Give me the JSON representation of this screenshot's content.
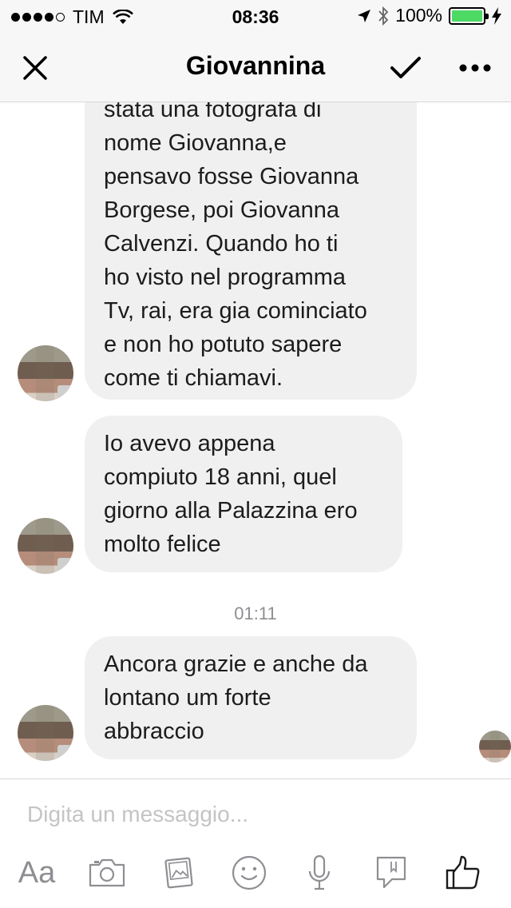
{
  "status_bar": {
    "carrier": "TIM",
    "time": "08:36",
    "battery": "100%",
    "signal_bars_filled": 4,
    "signal_bars_total": 5,
    "battery_level": 1.0,
    "battery_color": "#4cd964"
  },
  "header": {
    "title": "Giovannina",
    "close_icon": "close-icon",
    "check_icon": "check-icon",
    "more_icon": "more-icon"
  },
  "messages": [
    {
      "lines": [
        "stata una fotografa di",
        "nome Giovanna,e",
        "pensavo fosse Giovanna",
        "Borgese, poi Giovanna",
        "Calvenzi. Quando ho ti",
        "ho visto nel programma",
        "Tv, rai, era gia cominciato",
        "e non ho potuto sapere",
        "come ti chiamavi."
      ]
    },
    {
      "lines": [
        "Io avevo appena",
        "compiuto 18 anni, quel",
        "giorno alla Palazzina ero",
        "molto felice"
      ]
    },
    {
      "lines": [
        "Ancora grazie e anche da",
        "lontano um forte",
        "abbraccio"
      ]
    }
  ],
  "timestamp": "01:11",
  "composer": {
    "placeholder": "Digita un messaggio...",
    "text_button": "Aa",
    "icons": [
      "camera-icon",
      "gallery-icon",
      "emoji-icon",
      "microphone-icon",
      "sticker-icon",
      "like-icon"
    ]
  }
}
